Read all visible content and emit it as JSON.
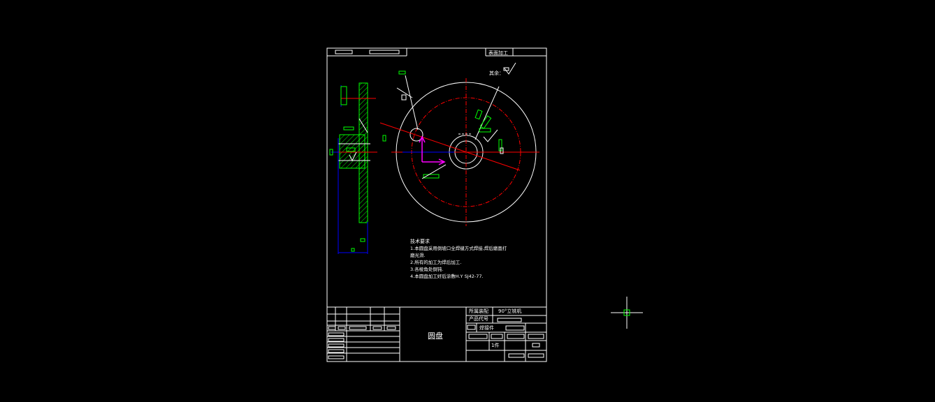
{
  "title_block": {
    "top_right_label": "表面加工",
    "other_label": "其余：",
    "field_machine_label": "所属装配",
    "field_machine_value": "90°立铣机",
    "field_code_label": "产品代号",
    "part_name": "圆盘",
    "weld_label": "焊接件",
    "count_label": "1件"
  },
  "tech_requirements": {
    "heading": "技术要求",
    "lines": [
      "1.本圆盘采用倒坡口全焊缝方式焊接,焊后磨面打",
      "磨光滑.",
      "2.所有的加工为焊后加工.",
      "3.各棱角处倒钝.",
      "4.本圆盘加工好后涂敷H.Y SJ42-77."
    ]
  },
  "colors": {
    "background": "#000000",
    "outline": "#ffffff",
    "dimension": "#00ff00",
    "centerline": "#ff0000",
    "extension": "#0000ff",
    "ucs": "#ff00ff"
  },
  "cursor": {
    "icon": "crosshair-cursor-icon"
  }
}
